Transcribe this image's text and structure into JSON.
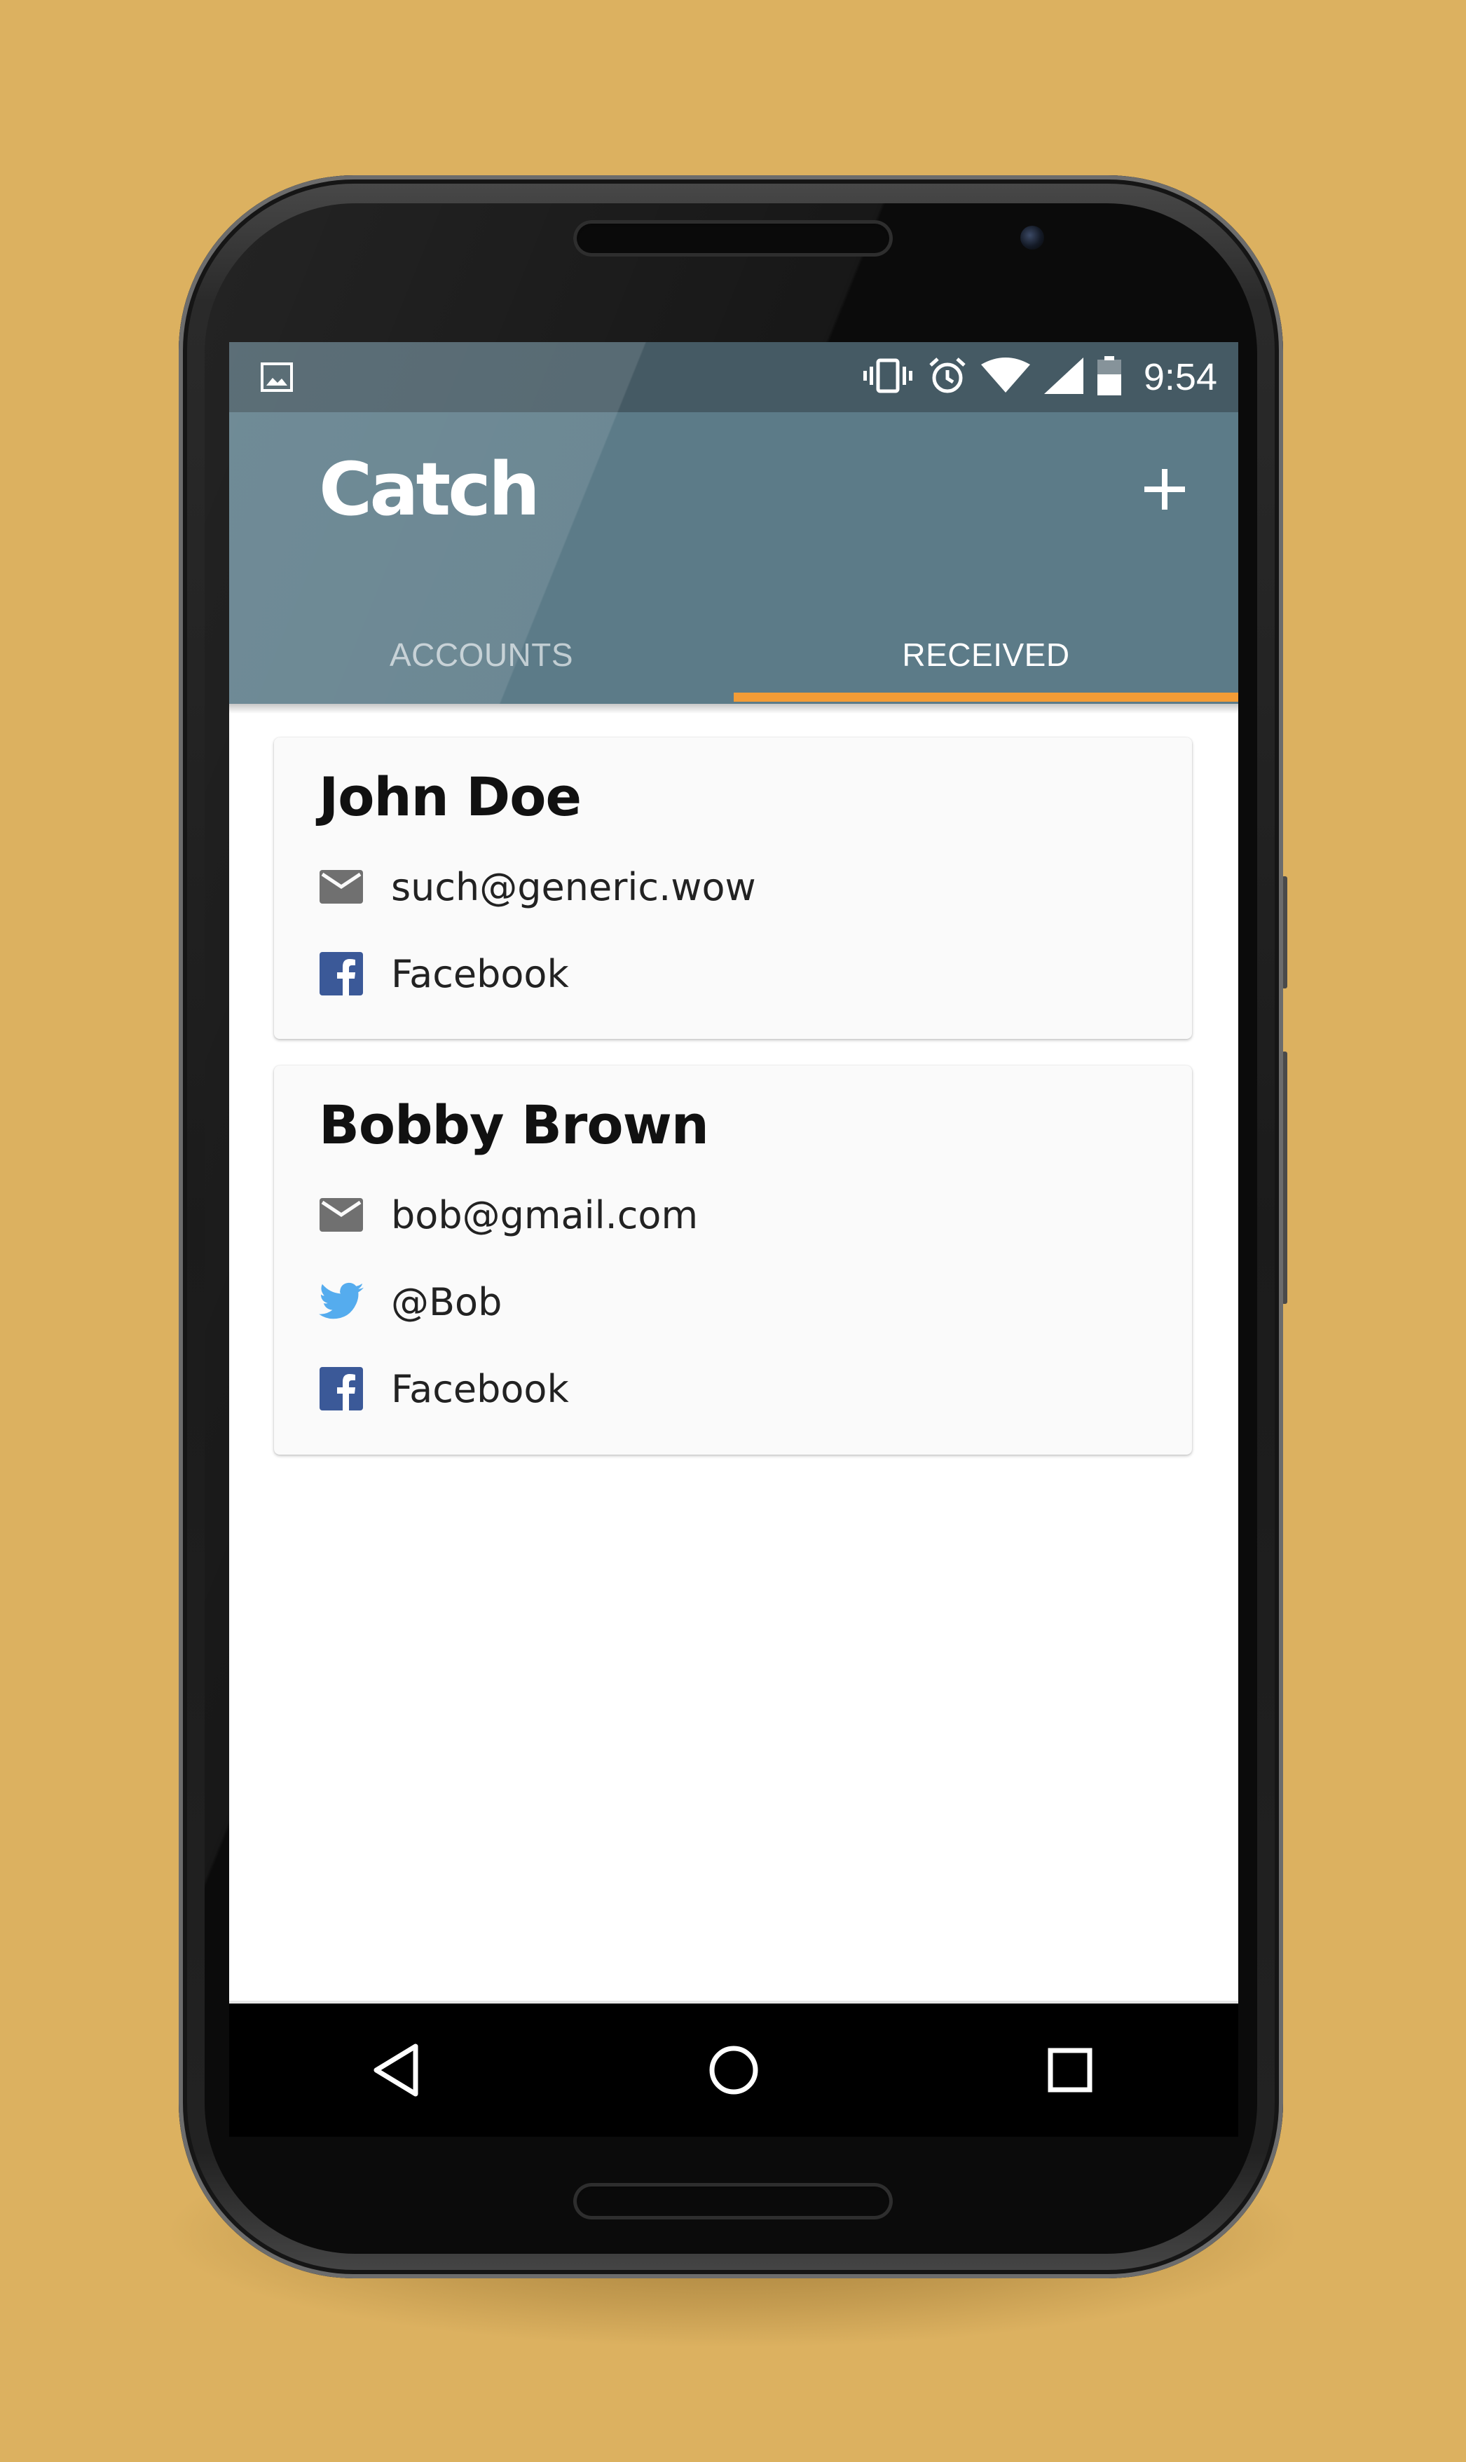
{
  "status_bar": {
    "time": "9:54",
    "icons": [
      "image-icon",
      "vibrate-icon",
      "alarm-icon",
      "wifi-icon",
      "cellular-signal-icon",
      "battery-icon"
    ]
  },
  "app_bar": {
    "title": "Catch",
    "add_icon": "plus-icon"
  },
  "tabs": [
    {
      "label": "ACCOUNTS",
      "active": false
    },
    {
      "label": "RECEIVED",
      "active": true
    }
  ],
  "contacts": [
    {
      "name": "John Doe",
      "entries": [
        {
          "icon": "email-icon",
          "text": "such@generic.wow"
        },
        {
          "icon": "facebook-icon",
          "text": "Facebook"
        }
      ]
    },
    {
      "name": "Bobby Brown",
      "entries": [
        {
          "icon": "email-icon",
          "text": "bob@gmail.com"
        },
        {
          "icon": "twitter-icon",
          "text": "@Bob"
        },
        {
          "icon": "facebook-icon",
          "text": "Facebook"
        }
      ]
    }
  ],
  "nav_bar": {
    "buttons": [
      "back-icon",
      "home-icon",
      "recents-icon"
    ]
  },
  "colors": {
    "background": "#dcb160",
    "status_bar": "#455a64",
    "app_bar": "#5c7b88",
    "tab_indicator": "#f39c36",
    "card": "#fafafa",
    "facebook": "#3b5998",
    "twitter": "#55acee"
  }
}
